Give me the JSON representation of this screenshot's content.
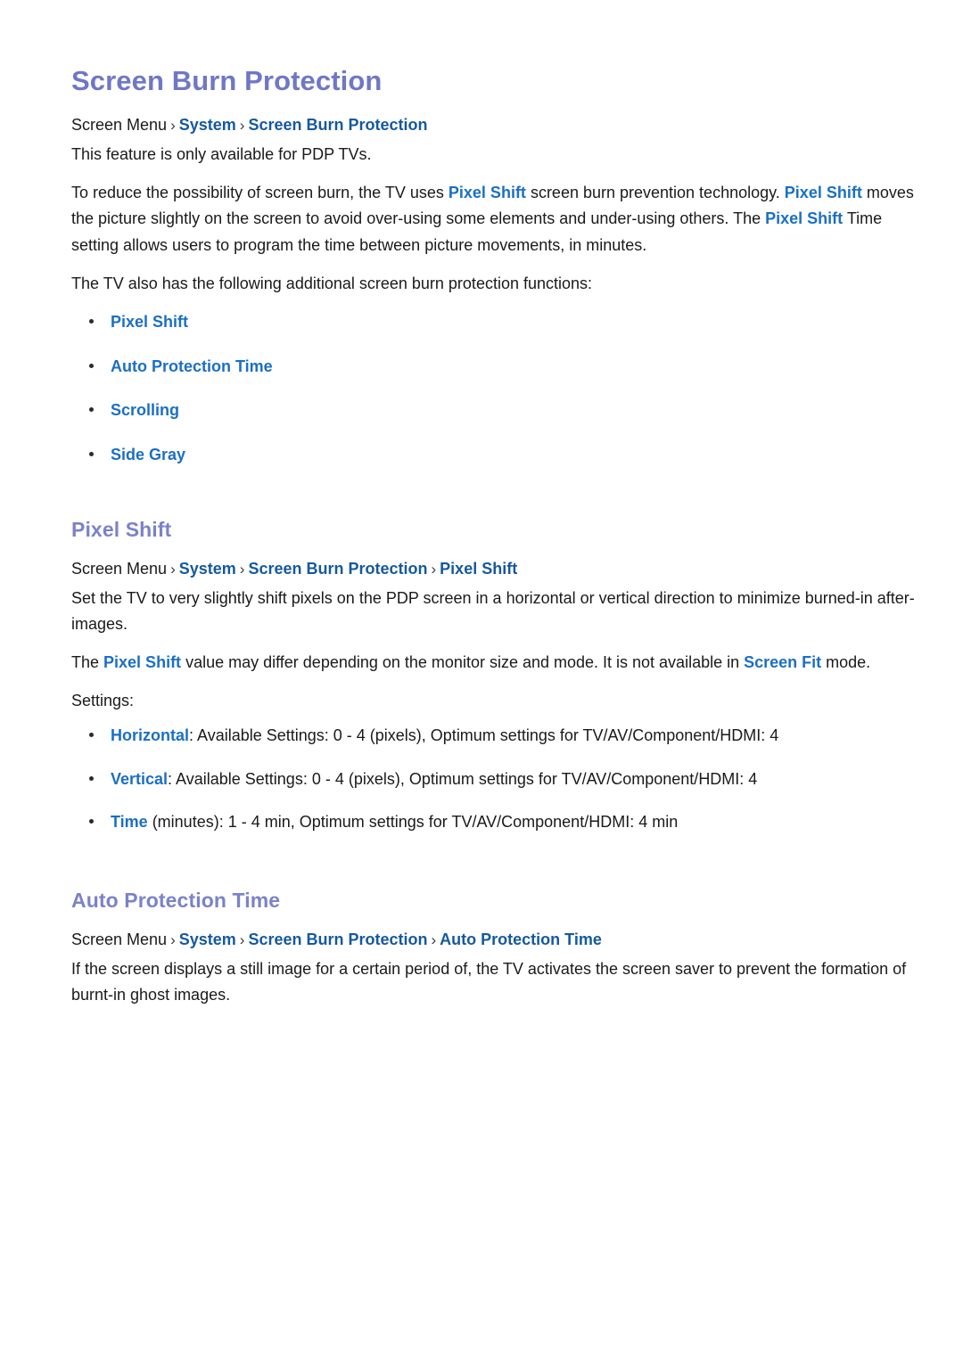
{
  "document": {
    "title": "Screen Burn Protection"
  },
  "sections": [
    {
      "id": "screen-burn-protection",
      "heading": "Screen Burn Protection",
      "breadcrumb": {
        "root": "Screen Menu",
        "separator": "›",
        "links": [
          "System",
          "Screen Burn Protection"
        ]
      },
      "paragraphs": [
        {
          "id": "availability",
          "runs": [
            {
              "text": "This feature is only available for PDP TVs.",
              "style": "plain"
            }
          ]
        },
        {
          "id": "pixel-shift-intro",
          "runs": [
            {
              "text": "To reduce the possibility of screen burn, the TV uses ",
              "style": "plain"
            },
            {
              "text": "Pixel Shift",
              "style": "link"
            },
            {
              "text": " screen burn prevention technology. ",
              "style": "plain"
            },
            {
              "text": "Pixel Shift",
              "style": "link"
            },
            {
              "text": " moves the picture slightly on the screen to avoid over-using some elements and under-using others. The ",
              "style": "plain"
            },
            {
              "text": "Pixel Shift",
              "style": "link"
            },
            {
              "text": " Time setting allows users to program the time between picture movements, in minutes.",
              "style": "plain"
            }
          ]
        },
        {
          "id": "additional-functions-lead",
          "runs": [
            {
              "text": "The TV also has the following additional screen burn protection functions:",
              "style": "plain"
            }
          ]
        }
      ],
      "bullet_list": {
        "kind": "links",
        "items": [
          {
            "link": "Pixel Shift",
            "rest": ""
          },
          {
            "link": "Auto Protection Time",
            "rest": ""
          },
          {
            "link": "Scrolling",
            "rest": ""
          },
          {
            "link": "Side Gray",
            "rest": ""
          }
        ]
      }
    },
    {
      "id": "pixel-shift",
      "heading": "Pixel Shift",
      "breadcrumb": {
        "root": "Screen Menu",
        "separator": "›",
        "links": [
          "System",
          "Screen Burn Protection",
          "Pixel Shift"
        ]
      },
      "paragraphs": [
        {
          "id": "pixel-shift-desc",
          "runs": [
            {
              "text": "Set the TV to very slightly shift pixels on the PDP screen in a horizontal or vertical direction to minimize burned-in after-images.",
              "style": "plain"
            }
          ]
        },
        {
          "id": "pixel-shift-note",
          "runs": [
            {
              "text": "The ",
              "style": "plain"
            },
            {
              "text": "Pixel Shift",
              "style": "link"
            },
            {
              "text": " value may differ depending on the monitor size and mode. It is not available in ",
              "style": "plain"
            },
            {
              "text": "Screen Fit",
              "style": "link"
            },
            {
              "text": " mode.",
              "style": "plain"
            }
          ]
        }
      ],
      "settings_label": "Settings:",
      "bullet_list": {
        "kind": "settings",
        "items": [
          {
            "link": "Horizontal",
            "rest": ": Available Settings: 0 - 4 (pixels), Optimum settings for TV/AV/Component/HDMI: 4"
          },
          {
            "link": "Vertical",
            "rest": ": Available Settings: 0 - 4 (pixels), Optimum settings for TV/AV/Component/HDMI: 4"
          },
          {
            "link": "Time",
            "rest": " (minutes): 1 - 4 min, Optimum settings for TV/AV/Component/HDMI: 4 min"
          }
        ]
      }
    },
    {
      "id": "auto-protection-time",
      "heading": "Auto Protection Time",
      "breadcrumb": {
        "root": "Screen Menu",
        "separator": "›",
        "links": [
          "System",
          "Screen Burn Protection",
          "Auto Protection Time"
        ]
      },
      "paragraphs": [
        {
          "id": "auto-protection-desc",
          "runs": [
            {
              "text": "If the screen displays a still image for a certain period of, the TV activates the screen saver to prevent the formation of burnt-in ghost images.",
              "style": "plain"
            }
          ]
        }
      ]
    }
  ],
  "colors": {
    "heading": "#7b82c8",
    "title": "#6f77c6",
    "breadcrumb_link": "#15599d",
    "inline_link": "#1b6fc4",
    "body_text": "#1a1a1a",
    "bullet_dot": "#2b2b2b",
    "background": "#ffffff"
  }
}
